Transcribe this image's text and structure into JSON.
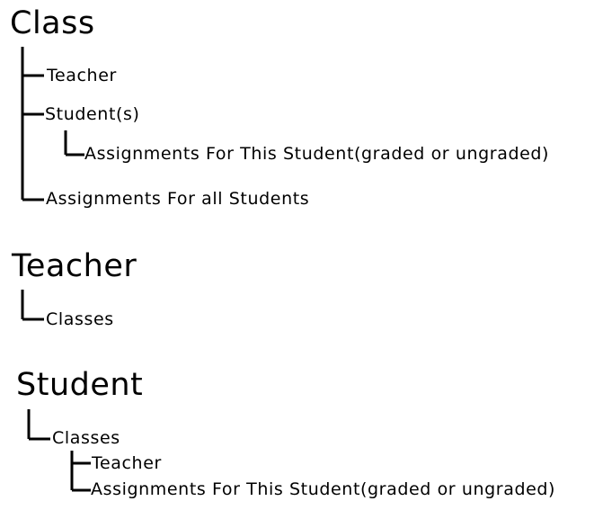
{
  "diagram": {
    "class_tree": {
      "title": "Class",
      "teacher": "Teacher",
      "students": "Student(s)",
      "student_assignments": "Assignments For This Student(graded or ungraded)",
      "all_assignments": "Assignments For all Students"
    },
    "teacher_tree": {
      "title": "Teacher",
      "classes": "Classes"
    },
    "student_tree": {
      "title": "Student",
      "classes": "Classes",
      "teacher": "Teacher",
      "assignments": "Assignments For This Student(graded or ungraded)"
    }
  }
}
